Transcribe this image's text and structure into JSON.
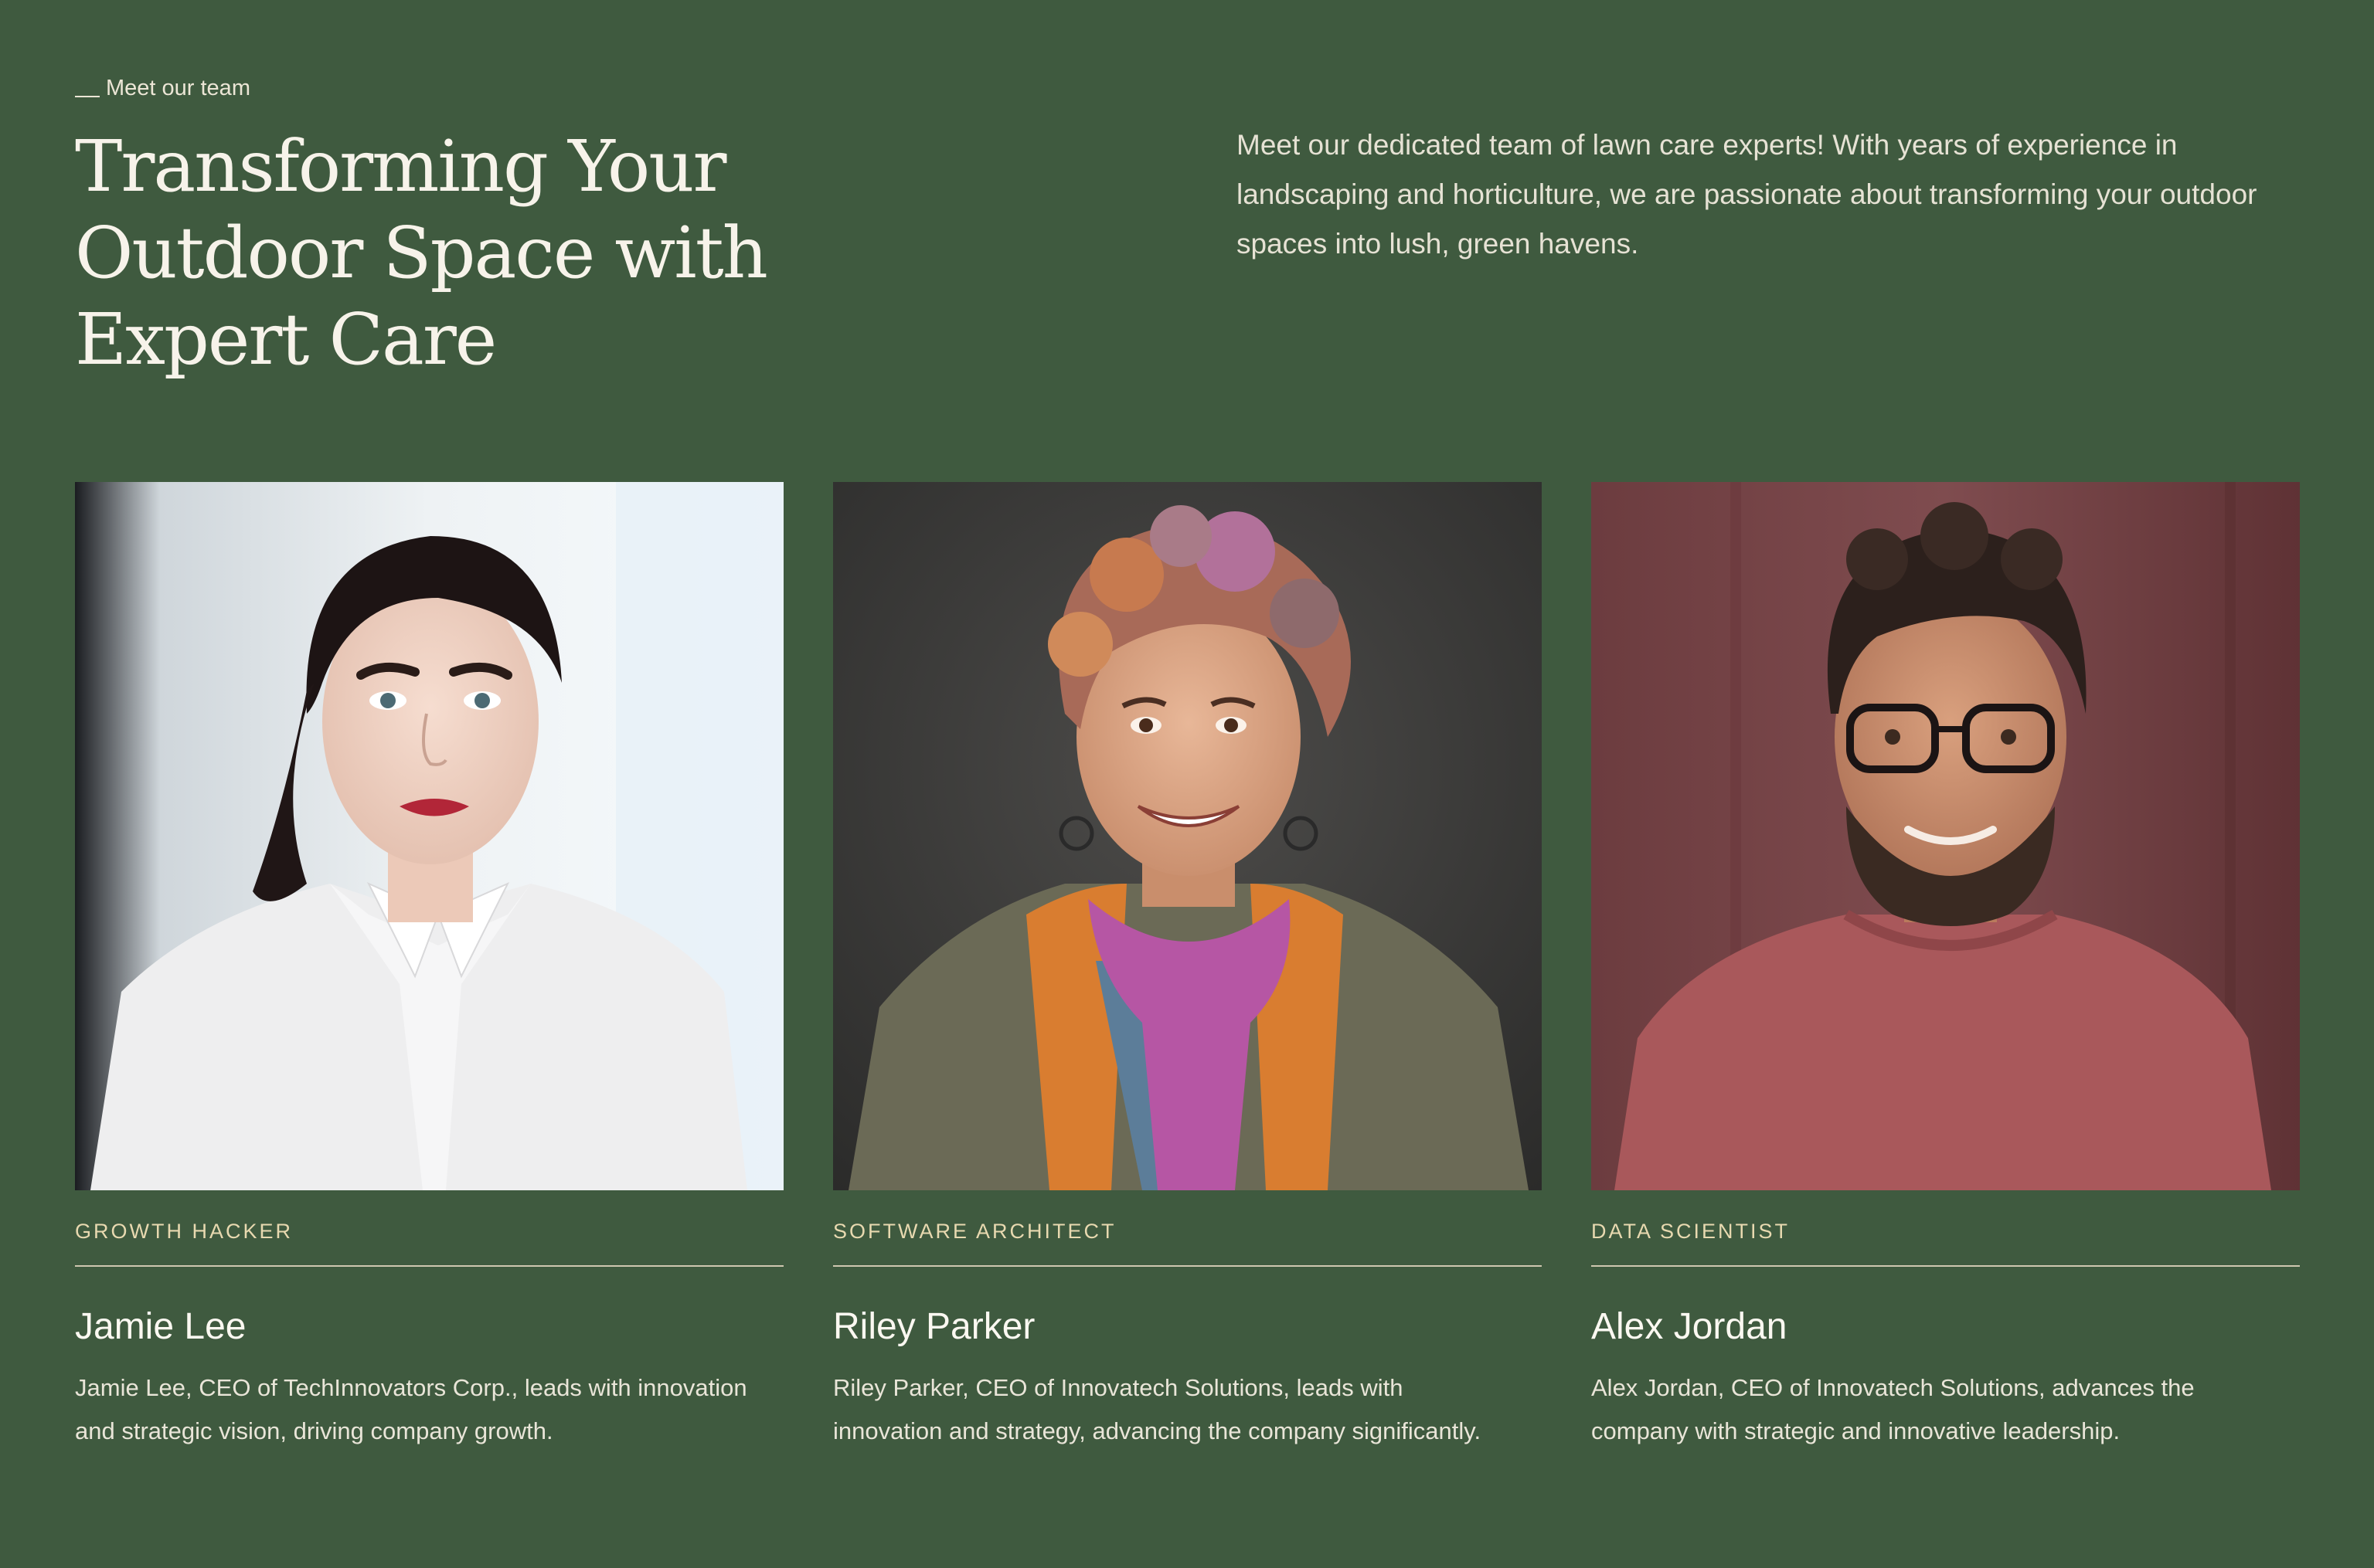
{
  "eyebrow": "Meet our team",
  "headline": "Transforming Your Outdoor Space with Expert Care",
  "intro": "Meet our dedicated team of lawn care experts! With years of experience in landscaping and horticulture, we are passionate about transforming your outdoor spaces into lush, green havens.",
  "team": [
    {
      "role": "GROWTH HACKER",
      "name": "Jamie Lee",
      "bio": "Jamie Lee, CEO of TechInnovators Corp., leads with innovation and strategic vision, driving company growth."
    },
    {
      "role": "SOFTWARE ARCHITECT",
      "name": "Riley Parker",
      "bio": "Riley Parker, CEO of Innovatech Solutions, leads with innovation and strategy, advancing the company significantly."
    },
    {
      "role": "DATA SCIENTIST",
      "name": "Alex Jordan",
      "bio": "Alex Jordan, CEO of Innovatech Solutions, advances the company with strategic and innovative leadership."
    }
  ],
  "colors": {
    "background": "#3f5a3f",
    "role_text": "#e8d9b0",
    "divider": "#cfc8b0"
  }
}
